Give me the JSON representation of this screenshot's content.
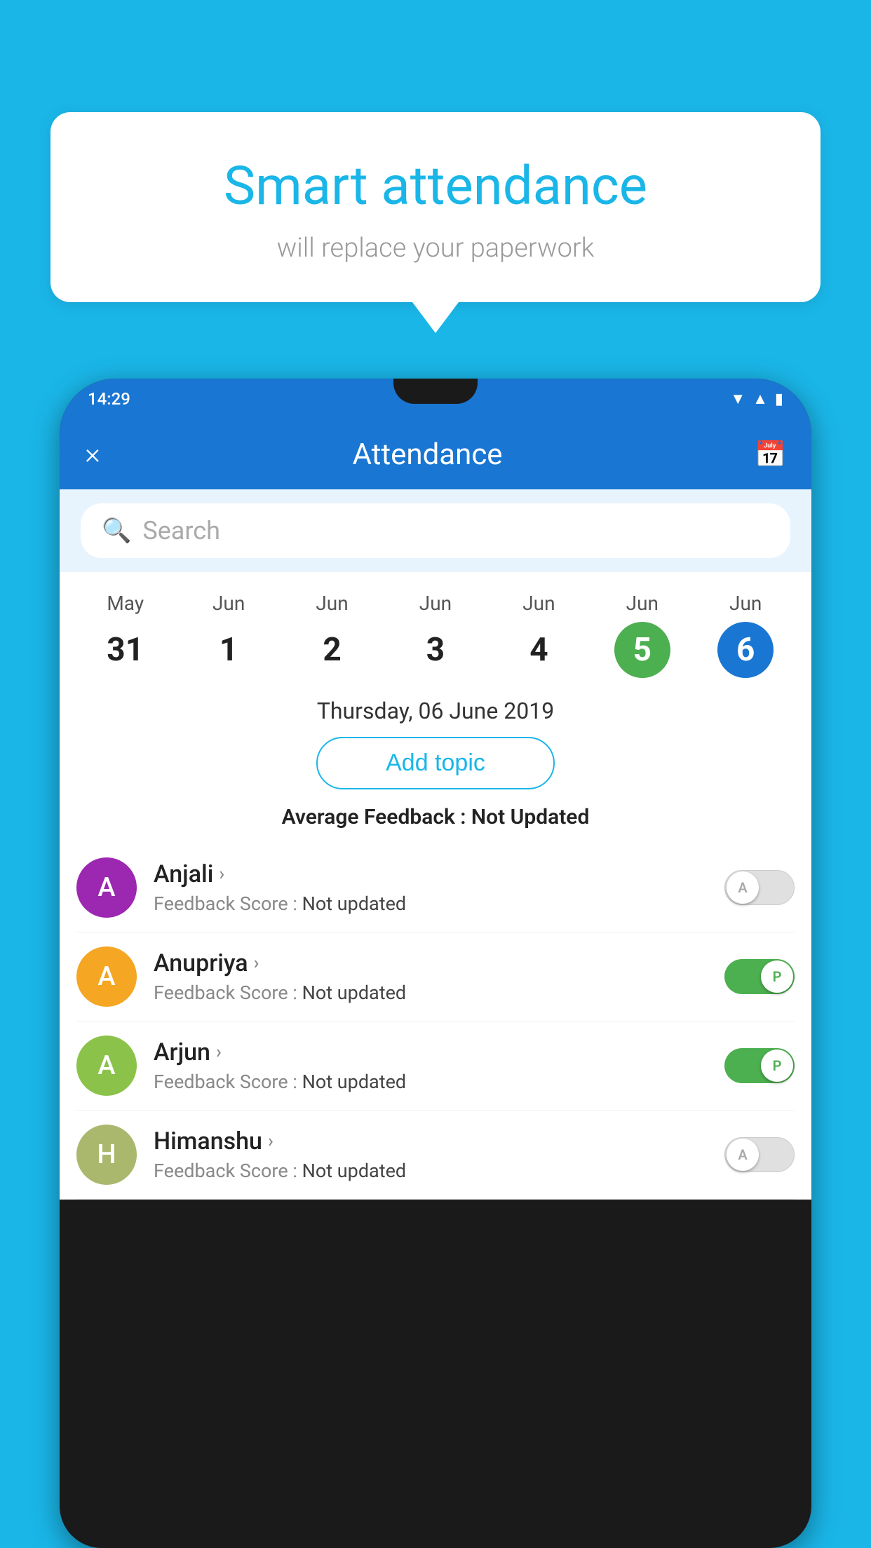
{
  "background_color": "#1ab6e8",
  "speech_bubble": {
    "title": "Smart attendance",
    "subtitle": "will replace your paperwork"
  },
  "status_bar": {
    "time": "14:29",
    "icons": [
      "wifi",
      "signal",
      "battery"
    ]
  },
  "app_bar": {
    "close_label": "×",
    "title": "Attendance",
    "calendar_icon": "📅"
  },
  "search": {
    "placeholder": "Search"
  },
  "calendar": {
    "days": [
      {
        "month": "May",
        "num": "31",
        "state": "normal"
      },
      {
        "month": "Jun",
        "num": "1",
        "state": "normal"
      },
      {
        "month": "Jun",
        "num": "2",
        "state": "normal"
      },
      {
        "month": "Jun",
        "num": "3",
        "state": "normal"
      },
      {
        "month": "Jun",
        "num": "4",
        "state": "normal"
      },
      {
        "month": "Jun",
        "num": "5",
        "state": "today"
      },
      {
        "month": "Jun",
        "num": "6",
        "state": "selected"
      }
    ]
  },
  "selected_date": "Thursday, 06 June 2019",
  "add_topic_label": "Add topic",
  "average_feedback": {
    "label": "Average Feedback : ",
    "value": "Not Updated"
  },
  "students": [
    {
      "name": "Anjali",
      "avatar_letter": "A",
      "avatar_color": "#9c27b0",
      "feedback_label": "Feedback Score : ",
      "feedback_value": "Not updated",
      "toggle_state": "off",
      "toggle_label": "A"
    },
    {
      "name": "Anupriya",
      "avatar_letter": "A",
      "avatar_color": "#f5a623",
      "feedback_label": "Feedback Score : ",
      "feedback_value": "Not updated",
      "toggle_state": "on",
      "toggle_label": "P"
    },
    {
      "name": "Arjun",
      "avatar_letter": "A",
      "avatar_color": "#8bc34a",
      "feedback_label": "Feedback Score : ",
      "feedback_value": "Not updated",
      "toggle_state": "on",
      "toggle_label": "P"
    },
    {
      "name": "Himanshu",
      "avatar_letter": "H",
      "avatar_color": "#aab86e",
      "feedback_label": "Feedback Score : ",
      "feedback_value": "Not updated",
      "toggle_state": "off",
      "toggle_label": "A"
    }
  ]
}
